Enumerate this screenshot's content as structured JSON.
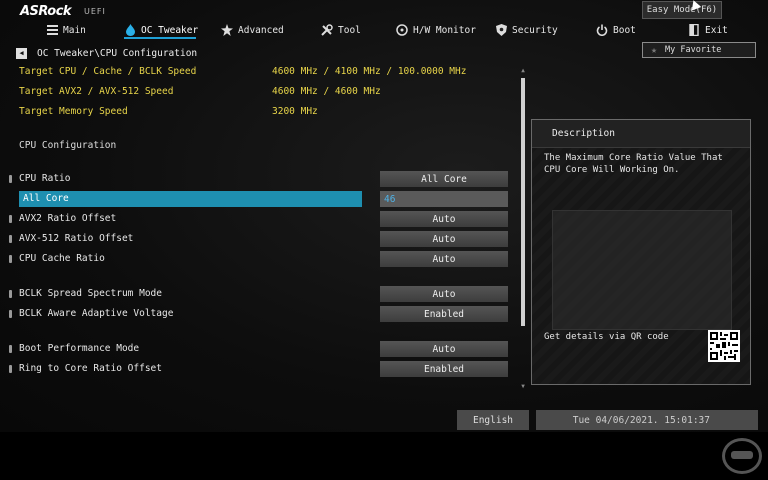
{
  "header": {
    "brand": "ASRock",
    "brand_sub": "UEFI",
    "easy_mode_label": "Easy Mode(F6)",
    "favorite_label": "My Favorite"
  },
  "tabs": [
    {
      "label": "Main",
      "icon": "list-icon"
    },
    {
      "label": "OC Tweaker",
      "icon": "flame-icon",
      "active": true
    },
    {
      "label": "Advanced",
      "icon": "star-icon"
    },
    {
      "label": "Tool",
      "icon": "wrench-icon"
    },
    {
      "label": "H/W Monitor",
      "icon": "monitor-icon"
    },
    {
      "label": "Security",
      "icon": "shield-icon"
    },
    {
      "label": "Boot",
      "icon": "power-icon"
    },
    {
      "label": "Exit",
      "icon": "exit-icon"
    }
  ],
  "breadcrumb": "OC Tweaker\\CPU Configuration",
  "info": [
    {
      "label": "Target CPU / Cache / BCLK Speed",
      "value": "4600 MHz / 4100 MHz / 100.0000 MHz"
    },
    {
      "label": "Target AVX2 / AVX-512 Speed",
      "value": "4600 MHz / 4600 MHz"
    },
    {
      "label": "Target Memory Speed",
      "value": "3200 MHz"
    }
  ],
  "section_title": "CPU Configuration",
  "options": [
    {
      "label": "CPU  Ratio",
      "value": "All Core"
    },
    {
      "label": "All Core",
      "value": "46",
      "selected": true
    },
    {
      "label": "AVX2 Ratio Offset",
      "value": "Auto"
    },
    {
      "label": "AVX-512 Ratio Offset",
      "value": "Auto"
    },
    {
      "label": "CPU  Cache Ratio",
      "value": "Auto"
    },
    {
      "label": "BCLK Spread Spectrum Mode",
      "value": "Auto"
    },
    {
      "label": "BCLK Aware Adaptive Voltage",
      "value": "Enabled"
    },
    {
      "label": "Boot Performance Mode",
      "value": "Auto"
    },
    {
      "label": "Ring to Core Ratio Offset",
      "value": "Enabled"
    }
  ],
  "description": {
    "title": "Description",
    "text": "The Maximum Core Ratio Value That CPU Core Will Working On.",
    "qr_label": "Get details via QR code"
  },
  "footer": {
    "language": "English",
    "datetime": "Tue 04/06/2021. 15:01:37"
  },
  "colors": {
    "accent": "#1e8fb0",
    "info_text": "#e8d54a",
    "selected_value": "#4fb3e8"
  }
}
